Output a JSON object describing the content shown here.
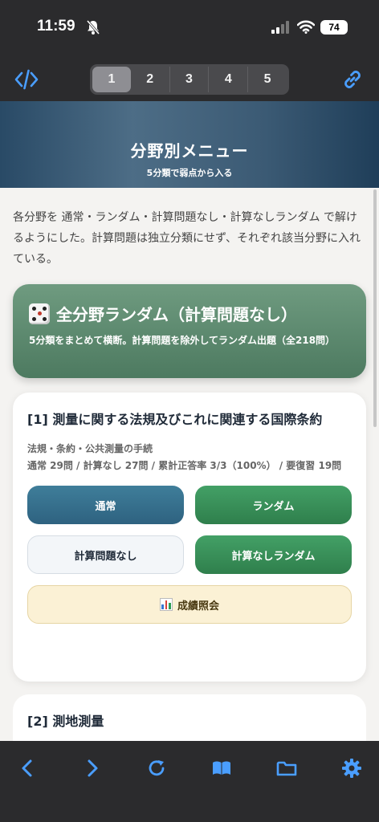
{
  "status": {
    "time": "11:59",
    "battery": "74"
  },
  "pager": {
    "pages": [
      "1",
      "2",
      "3",
      "4",
      "5"
    ],
    "active": "1"
  },
  "hero": {
    "title": "分野別メニュー",
    "subtitle": "5分類で弱点から入る"
  },
  "intro": "各分野を 通常・ランダム・計算問題なし・計算なしランダム で解けるようにした。計算問題は独立分類にせず、それぞれ該当分野に入れている。",
  "random_all": {
    "icon": "dice-icon",
    "title": "全分野ランダム（計算問題なし）",
    "description": "5分類をまとめて横断。計算問題を除外してランダム出題（全218問）"
  },
  "section1": {
    "title": "[1] 測量に関する法規及びこれに関連する国際条約",
    "category": "法規・条約・公共測量の手続",
    "stats": "通常 29問 / 計算なし 27問 / 累計正答率 3/3（100%） / 要復習 19問",
    "buttons": {
      "normal": "通常",
      "random": "ランダム",
      "no_calc": "計算問題なし",
      "no_calc_random": "計算なしランダム",
      "results": "成績照会"
    }
  },
  "section2": {
    "title": "[2] 測地測量"
  },
  "colors": {
    "accent_blue": "#4a9eff",
    "hero": "#2f5070",
    "random_green": "#5c8a6e"
  }
}
